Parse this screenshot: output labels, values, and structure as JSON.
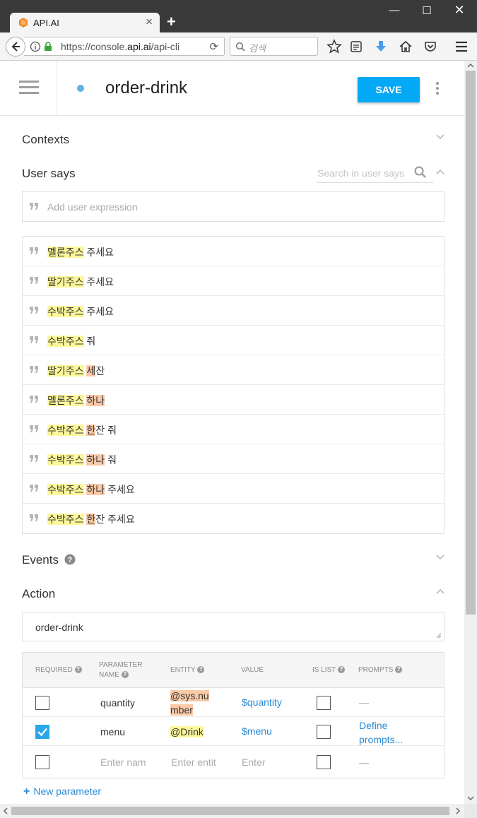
{
  "browser": {
    "tab_title": "API.AI",
    "url_prefix": "https://console.",
    "url_domain": "api.ai",
    "url_suffix": "/api-cli",
    "search_placeholder": "검색"
  },
  "header": {
    "intent_name": "order-drink",
    "save_label": "SAVE",
    "status_color": "#5fb0e8"
  },
  "sections": {
    "contexts": "Contexts",
    "user_says": "User says",
    "user_says_search_placeholder": "Search in user says",
    "add_expression_placeholder": "Add user expression",
    "events": "Events",
    "action": "Action"
  },
  "user_says": [
    [
      {
        "t": "멜론주스",
        "h": "y"
      },
      {
        "t": " 주세요",
        "h": ""
      }
    ],
    [
      {
        "t": "딸기주스",
        "h": "y"
      },
      {
        "t": " 주세요",
        "h": ""
      }
    ],
    [
      {
        "t": "수박주스",
        "h": "y"
      },
      {
        "t": " 주세요",
        "h": ""
      }
    ],
    [
      {
        "t": "수박주스",
        "h": "y"
      },
      {
        "t": " 줘",
        "h": ""
      }
    ],
    [
      {
        "t": "딸기주스",
        "h": "y"
      },
      {
        "t": " ",
        "h": ""
      },
      {
        "t": "세",
        "h": "o"
      },
      {
        "t": "잔",
        "h": ""
      }
    ],
    [
      {
        "t": "멜론주스",
        "h": "y"
      },
      {
        "t": " ",
        "h": ""
      },
      {
        "t": "하나",
        "h": "o"
      }
    ],
    [
      {
        "t": "수박주스",
        "h": "y"
      },
      {
        "t": " ",
        "h": ""
      },
      {
        "t": "한",
        "h": "o"
      },
      {
        "t": "잔 줘",
        "h": ""
      }
    ],
    [
      {
        "t": "수박주스",
        "h": "y"
      },
      {
        "t": " ",
        "h": ""
      },
      {
        "t": "하나",
        "h": "o"
      },
      {
        "t": " 줘",
        "h": ""
      }
    ],
    [
      {
        "t": "수박주스",
        "h": "y"
      },
      {
        "t": " ",
        "h": ""
      },
      {
        "t": "하나",
        "h": "o"
      },
      {
        "t": " 주세요",
        "h": ""
      }
    ],
    [
      {
        "t": "수박주스",
        "h": "y"
      },
      {
        "t": " ",
        "h": ""
      },
      {
        "t": "한",
        "h": "o"
      },
      {
        "t": "잔 주세요",
        "h": ""
      }
    ]
  ],
  "action": {
    "value": "order-drink"
  },
  "params": {
    "headers": {
      "required": "REQUIRED",
      "parameter_name_1": "PARAMETER",
      "parameter_name_2": "NAME",
      "entity": "ENTITY",
      "value": "VALUE",
      "is_list": "IS LIST",
      "prompts": "PROMPTS"
    },
    "rows": [
      {
        "required": false,
        "name": "quantity",
        "entity_1": "@sys.nu",
        "entity_2": "mber",
        "value": "$quantity",
        "is_list": false,
        "prompts": "—"
      },
      {
        "required": true,
        "name": "menu",
        "entity_1": "@Drink",
        "value": "$menu",
        "is_list": false,
        "prompts_1": "Define",
        "prompts_2": "prompts..."
      }
    ],
    "empty_row": {
      "name_placeholder": "Enter nam",
      "entity_placeholder": "Enter entit",
      "value_placeholder": "Enter",
      "prompts": "—"
    },
    "new_parameter": "New parameter"
  }
}
